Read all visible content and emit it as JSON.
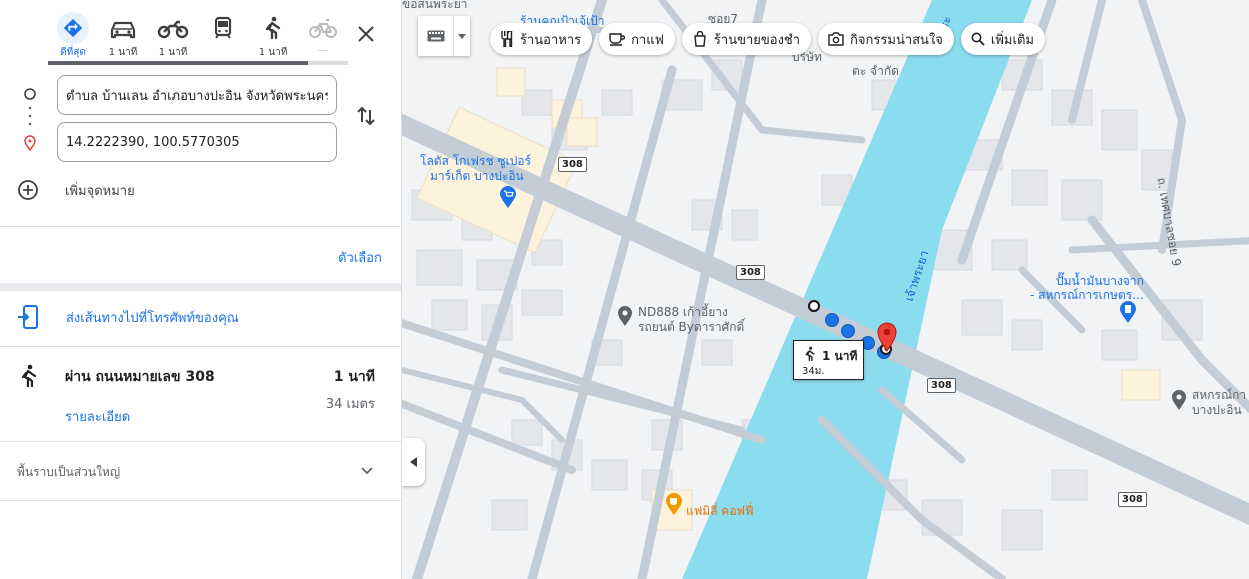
{
  "travel_modes": [
    {
      "name": "best",
      "label": "ดีที่สุด",
      "icon": "directions-icon"
    },
    {
      "name": "car",
      "label": "1 นาที",
      "icon": "car-icon"
    },
    {
      "name": "motorcycle",
      "label": "1 นาที",
      "icon": "motorcycle-icon"
    },
    {
      "name": "transit",
      "label": "",
      "icon": "transit-icon"
    },
    {
      "name": "walk",
      "label": "1 นาที",
      "icon": "walk-icon"
    },
    {
      "name": "bicycle",
      "label": "—",
      "icon": "bicycle-icon"
    }
  ],
  "directions": {
    "origin_value": "ตำบล บ้านเลน อำเภอบางปะอิน จังหวัดพระนครศรีอยุธยา",
    "destination_value": "14.2222390, 100.5770305",
    "add_destination": "เพิ่มจุดหมาย",
    "options": "ตัวเลือก",
    "send_to_phone": "ส่งเส้นทางไปที่โทรศัพท์ของคุณ"
  },
  "route": {
    "title": "ผ่าน ถนนหมายเลข 308",
    "time": "1 นาที",
    "distance": "34 เมตร",
    "details": "รายละเอียด"
  },
  "terrain": "พื้นราบเป็นส่วนใหญ่",
  "map": {
    "chips": [
      {
        "label": "ร้านอาหาร",
        "icon": "restaurant-icon"
      },
      {
        "label": "กาแฟ",
        "icon": "coffee-icon"
      },
      {
        "label": "ร้านขายของชำ",
        "icon": "grocery-icon"
      },
      {
        "label": "กิจกรรมน่าสนใจ",
        "icon": "camera-icon"
      },
      {
        "label": "เพิ่มเติม",
        "icon": "search-icon"
      }
    ],
    "labels": {
      "top_shop": "ร้านคุณป้าเจ้เป้า",
      "top_street": "ซอย7",
      "top_left_partial": "ขอสนพระยา",
      "company_line1": "บริษัท",
      "company_line2": "ตะ จำกัด",
      "lotus_line1": "โลตัส โกเฟรช ซูเปอร์",
      "lotus_line2": "มาร์เก็ต บางปะอิน",
      "nd888_line1": "ND888 เก้าอี้ยาง",
      "nd888_line2": "รถยนต์ Byดาราศักดิ์",
      "gas_line1": "ปั๊มน้ำมันบางจาก",
      "gas_line2": "- สหกรณ์การเกษตร...",
      "coop_line1": "สหกรณ์กา",
      "coop_line2": "บางปะอิน",
      "coffee_name": "แฟมิลี่ คอฟฟี่",
      "river_top": "เจ้าพระ",
      "river_mid": "เจ้าพระยา",
      "soi_right": "ถ. เทศบาลซอย 9"
    },
    "shields": [
      "308",
      "308",
      "308",
      "308"
    ],
    "walk_time": "1 นาที",
    "walk_dist": "34ม."
  },
  "colors": {
    "accent": "#1a73e8",
    "river": "#8adcef",
    "road": "#c4ccd6",
    "pin": "#ea4335",
    "coffee_pin": "#f29900"
  }
}
